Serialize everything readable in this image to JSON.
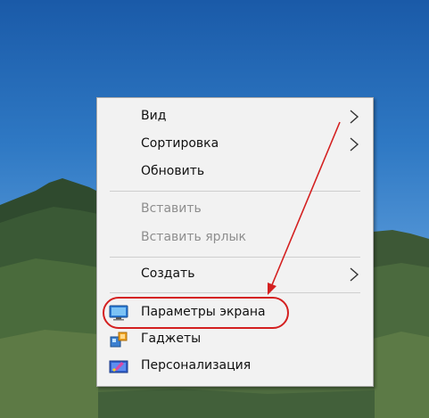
{
  "desktop": {
    "background_color": "#2f79c4"
  },
  "context_menu": {
    "items": [
      {
        "label": "Вид",
        "submenu": true,
        "enabled": true
      },
      {
        "label": "Сортировка",
        "submenu": true,
        "enabled": true
      },
      {
        "label": "Обновить",
        "submenu": false,
        "enabled": true
      },
      {
        "label": "Вставить",
        "submenu": false,
        "enabled": false
      },
      {
        "label": "Вставить ярлык",
        "submenu": false,
        "enabled": false
      },
      {
        "label": "Создать",
        "submenu": true,
        "enabled": true
      },
      {
        "label": "Параметры экрана",
        "submenu": false,
        "enabled": true,
        "icon": "display-icon"
      },
      {
        "label": "Гаджеты",
        "submenu": false,
        "enabled": true,
        "icon": "gadgets-icon"
      },
      {
        "label": "Персонализация",
        "submenu": false,
        "enabled": true,
        "icon": "personalization-icon"
      }
    ]
  },
  "annotation": {
    "color": "#d42020",
    "highlighted_item": "Параметры экрана"
  }
}
